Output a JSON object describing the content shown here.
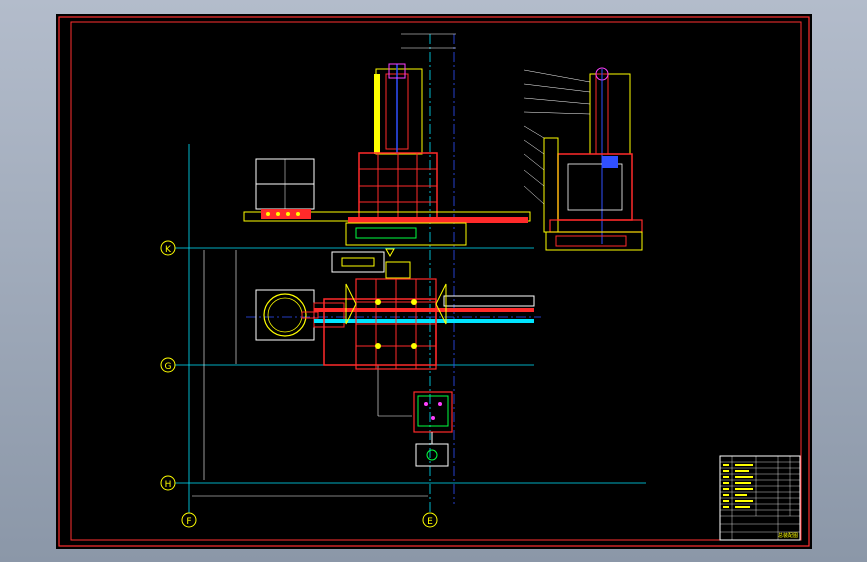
{
  "colors": {
    "viewer_bg": "#9aa5b5",
    "sheet_bg": "#000000",
    "frame": "#ff3030",
    "outline": "#ff2a2a",
    "yellow": "#ffff00",
    "white": "#ffffff",
    "cyan": "#00e5ff",
    "blue": "#3050ff",
    "green": "#00ff40",
    "magenta": "#ff40ff"
  },
  "grid_labels": {
    "row_K": "K",
    "row_G": "G",
    "row_H": "H",
    "col_F": "F",
    "col_E": "E"
  },
  "title_block": {
    "drawing_label": "总装配图"
  },
  "icons": {
    "grid_bubble": "circle-axis-marker"
  }
}
